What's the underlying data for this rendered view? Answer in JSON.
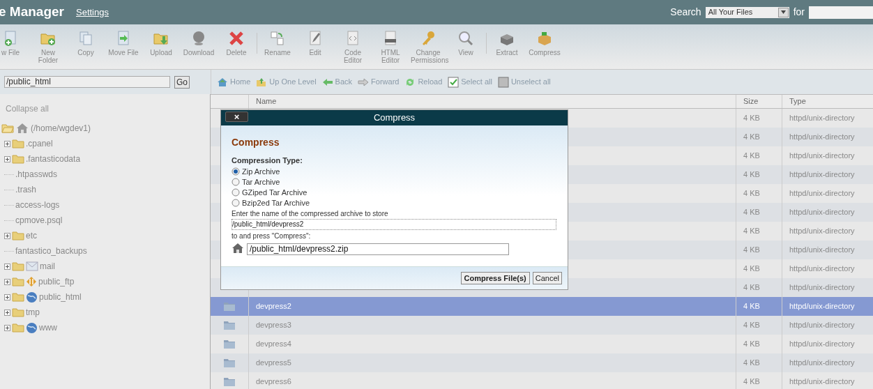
{
  "header": {
    "title": "e Manager",
    "settings_link": "Settings",
    "search_label": "Search",
    "search_scope": "All Your Files",
    "for_label": "for"
  },
  "toolbar": {
    "groups": [
      [
        {
          "label": "w File"
        },
        {
          "label": "New Folder"
        },
        {
          "label": "Copy"
        },
        {
          "label": "Move File"
        },
        {
          "label": "Upload"
        },
        {
          "label": "Download"
        },
        {
          "label": "Delete"
        }
      ],
      [
        {
          "label": "Rename"
        },
        {
          "label": "Edit"
        },
        {
          "label": "Code Editor"
        },
        {
          "label": "HTML Editor"
        },
        {
          "label": "Change Permissions"
        },
        {
          "label": "View"
        }
      ],
      [
        {
          "label": "Extract"
        },
        {
          "label": "Compress"
        }
      ]
    ]
  },
  "path_field": {
    "value": "/public_html",
    "button": "Go"
  },
  "nav": [
    {
      "label": "Home"
    },
    {
      "label": "Up One Level"
    },
    {
      "label": "Back"
    },
    {
      "label": "Forward"
    },
    {
      "label": "Reload"
    },
    {
      "label": "Select all"
    },
    {
      "label": "Unselect all"
    }
  ],
  "tree": {
    "collapse_all": "Collapse all",
    "root": {
      "label": "(/home/wgdev1)",
      "expanded": true,
      "children": [
        {
          "label": ".cpanel",
          "kind": "folder",
          "expanded": false
        },
        {
          "label": ".fantasticodata",
          "kind": "folder",
          "expanded": false
        },
        {
          "label": ".htpasswds",
          "kind": "plain"
        },
        {
          "label": ".trash",
          "kind": "plain"
        },
        {
          "label": "access-logs",
          "kind": "plain"
        },
        {
          "label": "cpmove.psql",
          "kind": "plain"
        },
        {
          "label": "etc",
          "kind": "folder",
          "expanded": false
        },
        {
          "label": "fantastico_backups",
          "kind": "plain"
        },
        {
          "label": "mail",
          "kind": "mail",
          "expanded": false
        },
        {
          "label": "public_ftp",
          "kind": "ftp",
          "expanded": false
        },
        {
          "label": "public_html",
          "kind": "web",
          "expanded": false
        },
        {
          "label": "tmp",
          "kind": "folder",
          "expanded": false
        },
        {
          "label": "www",
          "kind": "web",
          "expanded": false
        }
      ]
    }
  },
  "table": {
    "columns": [
      "Name",
      "Size",
      "Type"
    ],
    "rows": [
      {
        "size": "4 KB",
        "type": "httpd/unix-directory",
        "selected": false
      },
      {
        "size": "4 KB",
        "type": "httpd/unix-directory",
        "selected": false
      },
      {
        "size": "4 KB",
        "type": "httpd/unix-directory",
        "selected": false
      },
      {
        "size": "4 KB",
        "type": "httpd/unix-directory",
        "selected": false
      },
      {
        "size": "4 KB",
        "type": "httpd/unix-directory",
        "selected": false
      },
      {
        "size": "4 KB",
        "type": "httpd/unix-directory",
        "selected": false
      },
      {
        "size": "4 KB",
        "type": "httpd/unix-directory",
        "selected": false
      },
      {
        "size": "4 KB",
        "type": "httpd/unix-directory",
        "selected": false
      },
      {
        "size": "4 KB",
        "type": "httpd/unix-directory",
        "selected": false
      },
      {
        "size": "4 KB",
        "type": "httpd/unix-directory",
        "selected": false
      },
      {
        "name": "devpress2",
        "size": "4 KB",
        "type": "httpd/unix-directory",
        "selected": true
      },
      {
        "name": "devpress3",
        "size": "4 KB",
        "type": "httpd/unix-directory",
        "selected": false
      },
      {
        "name": "devpress4",
        "size": "4 KB",
        "type": "httpd/unix-directory",
        "selected": false
      },
      {
        "name": "devpress5",
        "size": "4 KB",
        "type": "httpd/unix-directory",
        "selected": false
      },
      {
        "name": "devpress6",
        "size": "4 KB",
        "type": "httpd/unix-directory",
        "selected": false
      }
    ]
  },
  "dialog": {
    "title": "Compress",
    "close": "×",
    "heading": "Compress",
    "type_label": "Compression Type:",
    "options": [
      {
        "label": "Zip Archive",
        "selected": true
      },
      {
        "label": "Tar Archive",
        "selected": false
      },
      {
        "label": "GZiped Tar Archive",
        "selected": false
      },
      {
        "label": "Bzip2ed Tar Archive",
        "selected": false
      }
    ],
    "prompt": "Enter the name of the compressed archive to store",
    "source": "/public_html/devpress2",
    "prompt2": "to and press \"Compress\":",
    "archive": "/public_html/devpress2.zip",
    "buttons": [
      "Compress File(s)",
      "Cancel"
    ]
  }
}
